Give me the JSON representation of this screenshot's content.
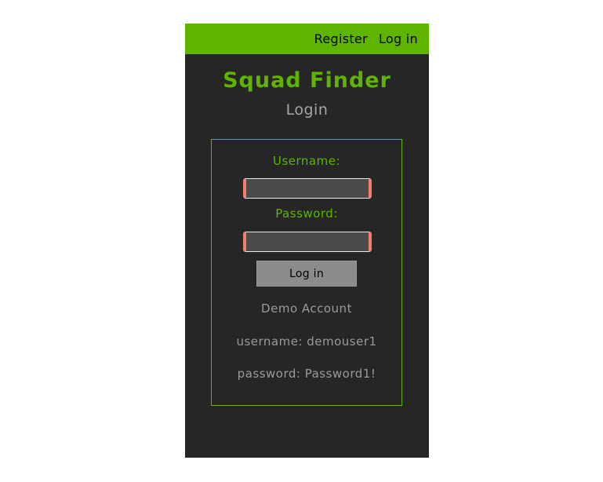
{
  "nav": {
    "register_label": "Register",
    "login_label": "Log in"
  },
  "brand": {
    "name": "Squad Finder"
  },
  "page": {
    "title": "Login"
  },
  "form": {
    "username_label": "Username:",
    "username_value": "",
    "password_label": "Password:",
    "password_value": "",
    "submit_label": "Log in"
  },
  "demo": {
    "heading": "Demo Account",
    "username_line": "username: demouser1",
    "password_line": "password: Password1!"
  },
  "colors": {
    "accent": "#5fb400",
    "panel_bg": "#262626",
    "input_border_accent": "#f08070",
    "button_bg": "#8c8c8c",
    "muted_text": "#a6a6a6"
  }
}
